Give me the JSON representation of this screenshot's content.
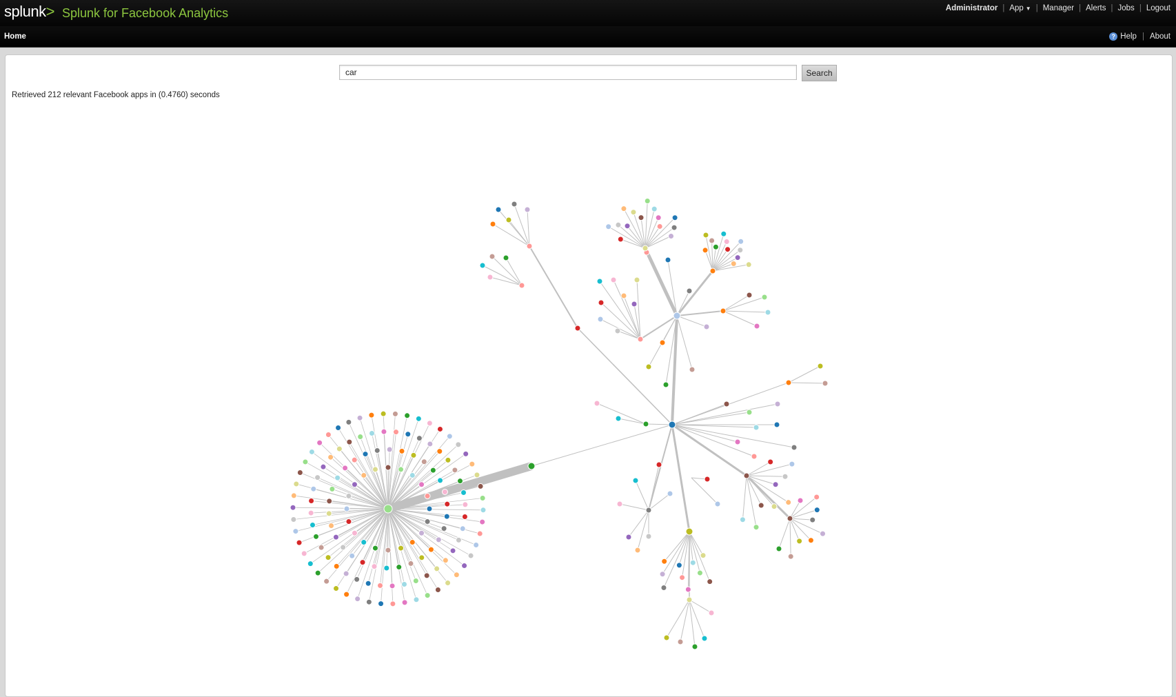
{
  "header": {
    "logo_word": "splunk",
    "logo_gt": ">",
    "app_title": "Splunk for Facebook Analytics",
    "account_menu": [
      "Administrator",
      "App",
      "Manager",
      "Alerts",
      "Jobs",
      "Logout"
    ]
  },
  "nav": {
    "home": "Home",
    "help": "Help",
    "about": "About",
    "help_glyph": "?"
  },
  "search": {
    "query": "car",
    "button_label": "Search"
  },
  "result_text": "Retrieved 212 relevant Facebook apps in (0.4760) seconds",
  "colors": {
    "brand_green": "#8cc63f",
    "link_gray": "#c0c0c0",
    "palette": [
      "#1f77b4",
      "#ff7f0e",
      "#2ca02c",
      "#d62728",
      "#9467bd",
      "#8c564b",
      "#e377c2",
      "#7f7f7f",
      "#bcbd22",
      "#17becf",
      "#aec7e8",
      "#ffbb78",
      "#98df8a",
      "#ff9896",
      "#c5b0d5",
      "#c49c94",
      "#f7b6d2",
      "#c7c7c7",
      "#dbdb8d",
      "#9edae5"
    ]
  },
  "graph": {
    "type": "force-directed network",
    "node_count": 212
  }
}
